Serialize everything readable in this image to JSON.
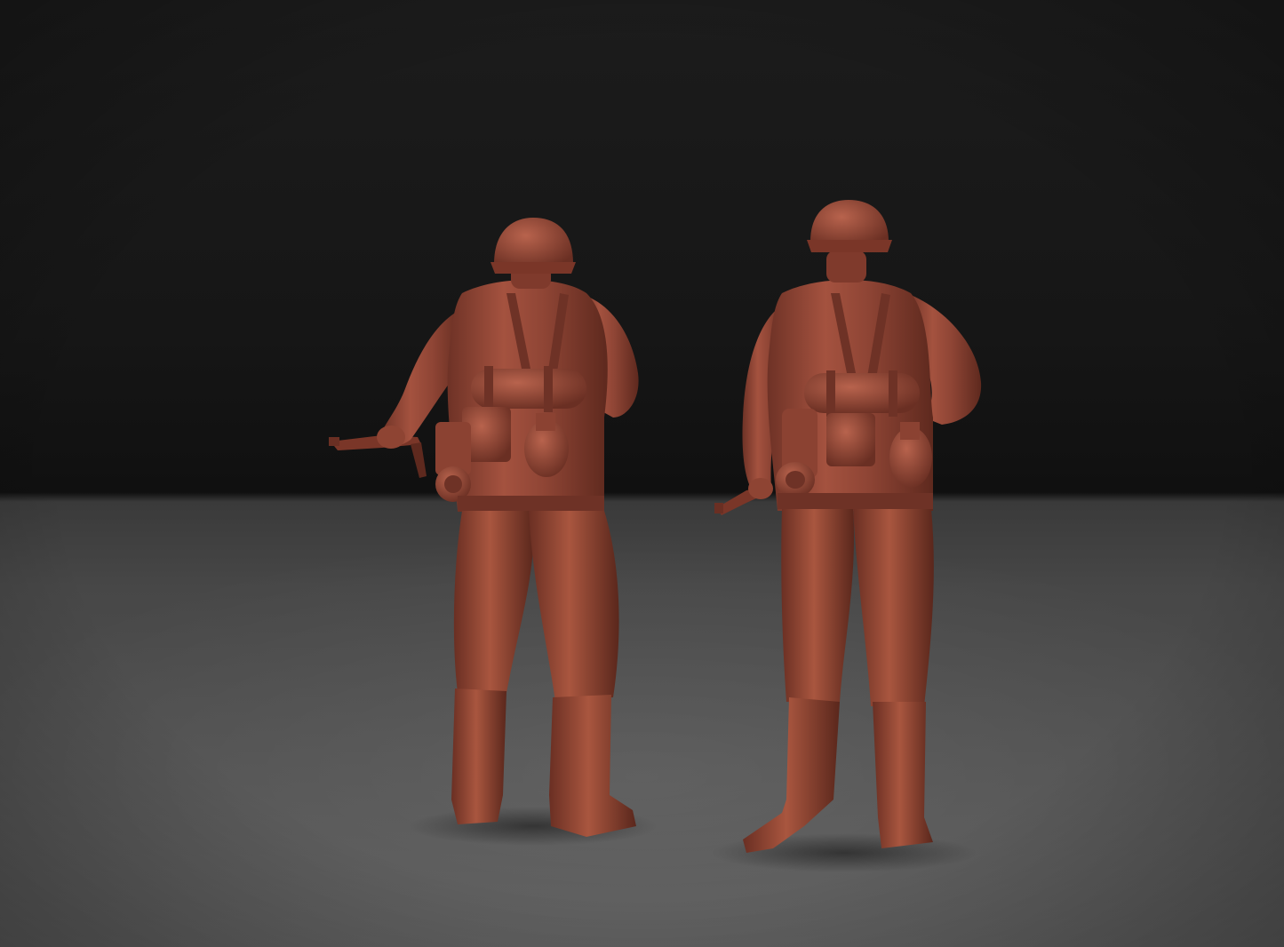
{
  "scene": {
    "figure_count": 2,
    "colors": {
      "backdrop_top": "#1a1a1a",
      "backdrop_horizon": "#111111",
      "floor": "#5a5a5a",
      "floor_far": "#474747",
      "clay": "#9a4c3c",
      "clay_dark": "#6e3226",
      "clay_light": "#b35f4b",
      "clay_shadow": "#4e2219"
    }
  }
}
